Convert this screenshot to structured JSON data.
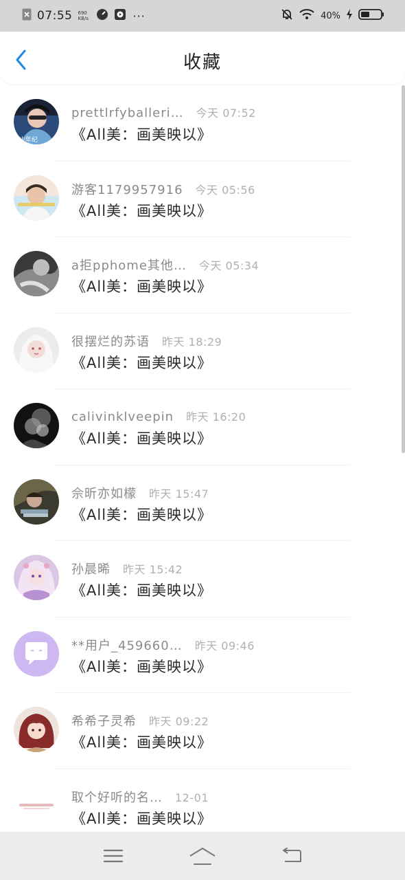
{
  "status_bar": {
    "time": "07:55",
    "speed": "690 KB/s",
    "dots": "···",
    "battery": "40%"
  },
  "header": {
    "title": "收藏"
  },
  "items": [
    {
      "username": "prettlrfyballeri…",
      "time": "今天 07:52",
      "title": "《All美：画美映以》"
    },
    {
      "username": "游客1179957916",
      "time": "今天 05:56",
      "title": "《All美：画美映以》"
    },
    {
      "username": "a拒pphome其他…",
      "time": "今天 05:34",
      "title": "《All美：画美映以》"
    },
    {
      "username": "很摆烂的苏语",
      "time": "昨天 18:29",
      "title": "《All美：画美映以》"
    },
    {
      "username": "calivinklveepin",
      "time": "昨天 16:20",
      "title": "《All美：画美映以》"
    },
    {
      "username": "佘昕亦如檬",
      "time": "昨天 15:47",
      "title": "《All美：画美映以》"
    },
    {
      "username": "孙晨晞",
      "time": "昨天 15:42",
      "title": "《All美：画美映以》"
    },
    {
      "username": "**用户_459660…",
      "time": "昨天 09:46",
      "title": "《All美：画美映以》"
    },
    {
      "username": "希希子灵希",
      "time": "昨天 09:22",
      "title": "《All美：画美映以》"
    },
    {
      "username": "取个好听的名…",
      "time": "12-01",
      "title": "《All美：画美映以》"
    }
  ],
  "avatar_labels": {
    "avatar0": "少年纪"
  },
  "colors": {
    "accent": "#1e88e5",
    "status_bar_bg": "#d6d6d6",
    "nav_bar_bg": "#ececec"
  }
}
